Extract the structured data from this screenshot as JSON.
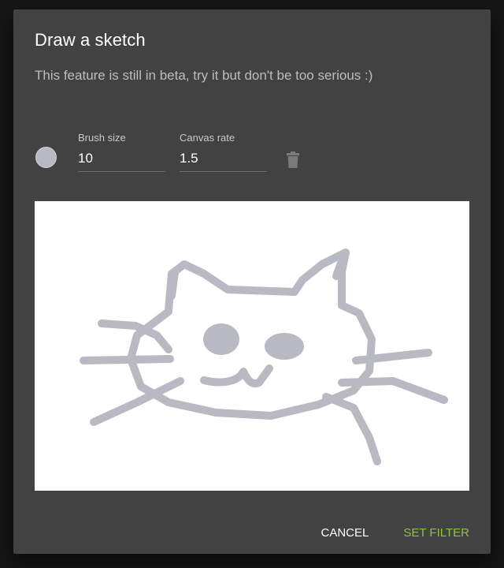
{
  "dialog": {
    "title": "Draw a sketch",
    "subtitle": "This feature is still in beta, try it but don't be too serious :)"
  },
  "controls": {
    "brush_color": "#b8b9c3",
    "brush_size": {
      "label": "Brush size",
      "value": "10"
    },
    "canvas_rate": {
      "label": "Canvas rate",
      "value": "1.5"
    },
    "clear_icon": "trash-icon"
  },
  "canvas": {
    "background": "#ffffff",
    "stroke_color": "#b8b9c3",
    "content": "cat sketch"
  },
  "actions": {
    "cancel_label": "CANCEL",
    "submit_label": "SET FILTER",
    "accent_color": "#8bc34a"
  }
}
